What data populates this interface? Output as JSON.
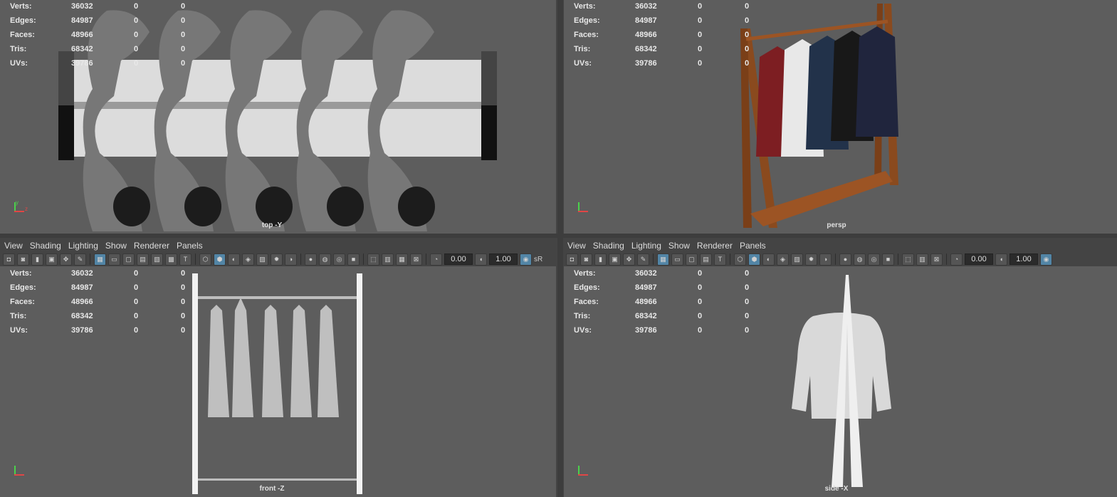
{
  "hud": {
    "labels": [
      "Verts:",
      "Edges:",
      "Faces:",
      "Tris:",
      "UVs:"
    ],
    "values": [
      "36032",
      "84987",
      "48966",
      "68342",
      "39786"
    ],
    "zero": "0"
  },
  "viewports": {
    "top": {
      "camera": "top -Y"
    },
    "persp": {
      "camera": "persp"
    },
    "front": {
      "camera": "front -Z"
    },
    "side": {
      "camera": "side -X"
    }
  },
  "menu": {
    "view": "View",
    "shading": "Shading",
    "lighting": "Lighting",
    "show": "Show",
    "renderer": "Renderer",
    "panels": "Panels"
  },
  "toolbar": {
    "exposure_value": "0.00",
    "gamma_value": "1.00",
    "color_space": "sR"
  },
  "axis": {
    "y": "y",
    "x": "x",
    "z": "z"
  },
  "colors": {
    "viewport_bg": "#5d5d5d",
    "wood": "#8a4a1e",
    "active_button": "#5285a6"
  }
}
